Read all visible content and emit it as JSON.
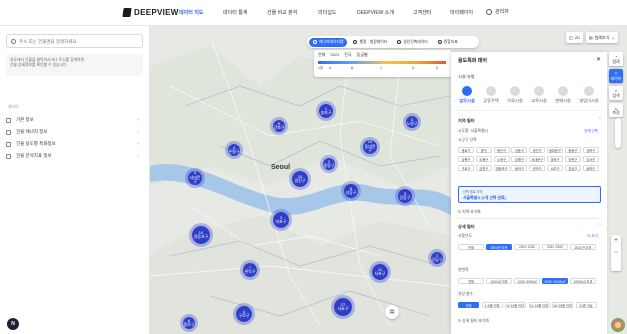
{
  "brand": {
    "name": "DEEPVIEW"
  },
  "nav": [
    "데이터 지도",
    "데이터 통계",
    "건물 비교 분석",
    "리더십드",
    "DEEPVIEW 소개",
    "고객센터",
    "마이페이지"
  ],
  "user": {
    "name": "관리자"
  },
  "left": {
    "search_placeholder": "주소 또는 건물명을 검색하세요",
    "notice_line1": "지도에서 건물을 클릭하시거나 주소를 검색하면",
    "notice_line2": "건물 상세정보를 확인할 수 있습니다.",
    "section": "레이어",
    "items": [
      "기본 정보",
      "건물 에너지 정보",
      "건물 용도별 특화정보",
      "건물 분석지표 정보"
    ]
  },
  "map": {
    "city_label": "Seoul",
    "modes": [
      "에너지데이터맵",
      "행정 · 법정데이터",
      "생산건축데이터",
      "종합지표"
    ],
    "legend": {
      "items": [
        "전체",
        "2021",
        "전국",
        "등급별"
      ],
      "ticks": [
        "1등",
        "A",
        "B",
        "C",
        "D",
        "E"
      ]
    },
    "clusters": [
      {
        "n": "1",
        "t": "송파구"
      },
      {
        "n": "6",
        "t": "강북구"
      },
      {
        "n": "3",
        "t": "노원구"
      },
      {
        "n": "4",
        "t": "은평구"
      },
      {
        "n": "6",
        "t": "종로구"
      },
      {
        "n": "3",
        "t": "중랑구"
      },
      {
        "n": "15",
        "t": "동대문구"
      },
      {
        "n": "5",
        "t": "서대문구"
      },
      {
        "n": "4",
        "t": "중구"
      },
      {
        "n": "15",
        "t": "광진구"
      },
      {
        "n": "8",
        "t": "성동구"
      },
      {
        "n": "3",
        "t": "강동구"
      },
      {
        "n": "3",
        "t": "마포구"
      },
      {
        "n": "14",
        "t": "영등포구"
      },
      {
        "n": "9",
        "t": "동작구"
      },
      {
        "n": "2",
        "t": "강남구"
      },
      {
        "n": "11",
        "t": "서초구"
      },
      {
        "n": "3",
        "t": "송파구"
      },
      {
        "n": "7",
        "t": "관악구"
      },
      {
        "n": "27",
        "t": "서초구"
      },
      {
        "n": "4",
        "t": "구로구"
      }
    ]
  },
  "tools": {
    "top": [
      "2D",
      "범례보기"
    ],
    "side": [
      "범례",
      "레이어",
      "검색",
      "측정"
    ]
  },
  "detail": {
    "title": "용도특화 데어",
    "facility_title": "시설 유형",
    "facilities": [
      "업무시설",
      "공동주택",
      "의료시설",
      "교육시설",
      "판매시설",
      "영업이시설"
    ],
    "region_title": "지역 필터",
    "city_label": "시도명: 서울특별시",
    "district_label": "시군구 선택",
    "select_all": "전체 선택",
    "districts": [
      "종로구",
      "중구",
      "용산구",
      "성동구",
      "광진구",
      "동대문구",
      "중랑구",
      "성북구",
      "강북구",
      "도봉구",
      "노원구",
      "은평구",
      "서대문구",
      "마포구",
      "양천구",
      "강서구",
      "구로구",
      "금천구",
      "영등포구",
      "동작구",
      "관악구",
      "서초구",
      "강남구",
      "송파구"
    ],
    "selected_hint": "선택 완료 지역",
    "selected_value": "서울특별시 (1개 선택 완료)",
    "reset": "지역 초기화",
    "detail_title": "상세 필터",
    "area_title": "연면적",
    "area_chips": [
      "전체",
      "1000㎡ 이하",
      "1000~3000㎡",
      "3000~10000㎡",
      "10000㎡ 초과"
    ],
    "year_title": "사용년도",
    "year_chips": [
      "전체",
      "2000년 이전",
      "2001~2010",
      "2011~2020",
      "2021년 이후"
    ],
    "floor_title": "지상 층수",
    "floor_chips": [
      "전체",
      "1~5층 이하",
      "6~10층 이하",
      "11~15층 이하",
      "16~20층 이하",
      "21층 이상"
    ],
    "more_link": "더 보기",
    "footer": "상세 필터 초기화"
  },
  "colors": {
    "accent": "#2f6df6",
    "cluster": "#2f3ec7"
  }
}
